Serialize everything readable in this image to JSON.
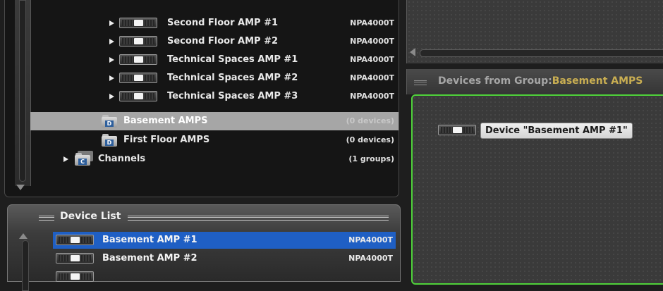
{
  "tree": {
    "rows": [
      {
        "label": "Second Floor AMP #1",
        "type": "NPA4000T"
      },
      {
        "label": "Second Floor AMP #2",
        "type": "NPA4000T"
      },
      {
        "label": "Technical Spaces AMP #1",
        "type": "NPA4000T"
      },
      {
        "label": "Technical Spaces AMP #2",
        "type": "NPA4000T"
      },
      {
        "label": "Technical Spaces AMP #3",
        "type": "NPA4000T"
      },
      {
        "label": "Basement AMPS",
        "count": "(0 devices)",
        "badge": "D"
      },
      {
        "label": "First Floor AMPS",
        "count": "(0 devices)",
        "badge": "D"
      },
      {
        "label": "Channels",
        "count": "(1 groups)",
        "badge": "C"
      }
    ]
  },
  "device_list": {
    "title": "Device List",
    "rows": [
      {
        "label": "Basement AMP #1",
        "type": "NPA4000T"
      },
      {
        "label": "Basement AMP #2",
        "type": "NPA4000T"
      }
    ]
  },
  "group_panel": {
    "title_prefix": "Devices from Group:",
    "group_name": "Basement AMPS",
    "device_label": "Device \"Basement AMP #1\""
  },
  "colors": {
    "selection_blue": "#1f5fc4",
    "selection_gray": "#a6a6a6",
    "group_border_green": "#4fd23a",
    "group_name_gold": "#c9ae52"
  }
}
